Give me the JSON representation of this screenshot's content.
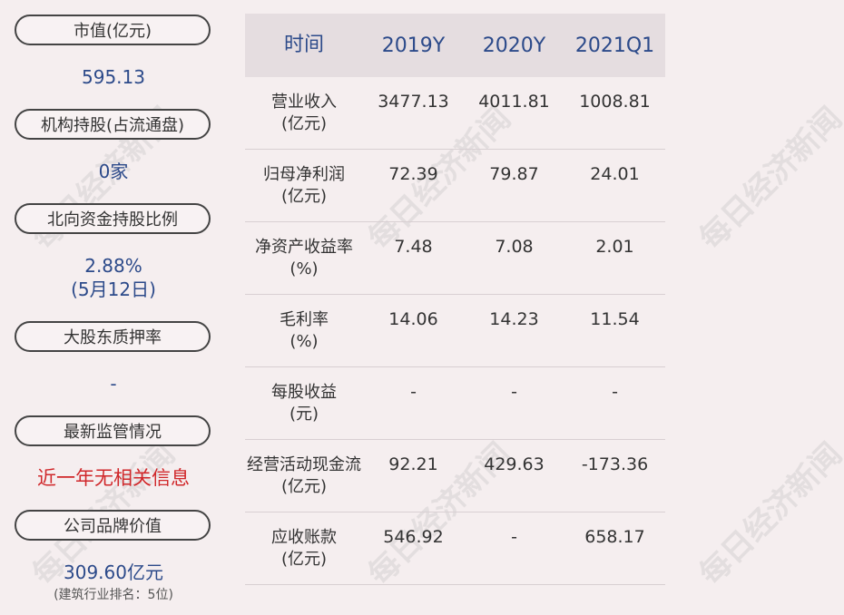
{
  "left": {
    "items": [
      {
        "label": "市值(亿元)",
        "value": "595.13"
      },
      {
        "label": "机构持股(占流通盘)",
        "value": "0家"
      },
      {
        "label": "北向资金持股比例",
        "value": "2.88%",
        "value2": "(5月12日)"
      },
      {
        "label": "大股东质押率",
        "value": "-"
      },
      {
        "label": "最新监管情况",
        "value": "近一年无相关信息"
      },
      {
        "label": "公司品牌价值",
        "value": "309.60亿元",
        "note": "(建筑行业排名：5位)"
      }
    ]
  },
  "table": {
    "headers": [
      "时间",
      "2019Y",
      "2020Y",
      "2021Q1"
    ],
    "rows": [
      {
        "name1": "营业收入",
        "name2": "(亿元)",
        "v": [
          "3477.13",
          "4011.81",
          "1008.81"
        ]
      },
      {
        "name1": "归母净利润",
        "name2": "(亿元)",
        "v": [
          "72.39",
          "79.87",
          "24.01"
        ]
      },
      {
        "name1": "净资产收益率",
        "name2": "(%)",
        "v": [
          "7.48",
          "7.08",
          "2.01"
        ]
      },
      {
        "name1": "毛利率",
        "name2": "(%)",
        "v": [
          "14.06",
          "14.23",
          "11.54"
        ]
      },
      {
        "name1": "每股收益",
        "name2": "(元)",
        "v": [
          "-",
          "-",
          "-"
        ]
      },
      {
        "name1": "经营活动现金流",
        "name2": "(亿元)",
        "v": [
          "92.21",
          "429.63",
          "-173.36"
        ]
      },
      {
        "name1": "应收账款",
        "name2": "(亿元)",
        "v": [
          "546.92",
          "-",
          "658.17"
        ]
      }
    ]
  },
  "watermark": "每日经济新闻"
}
